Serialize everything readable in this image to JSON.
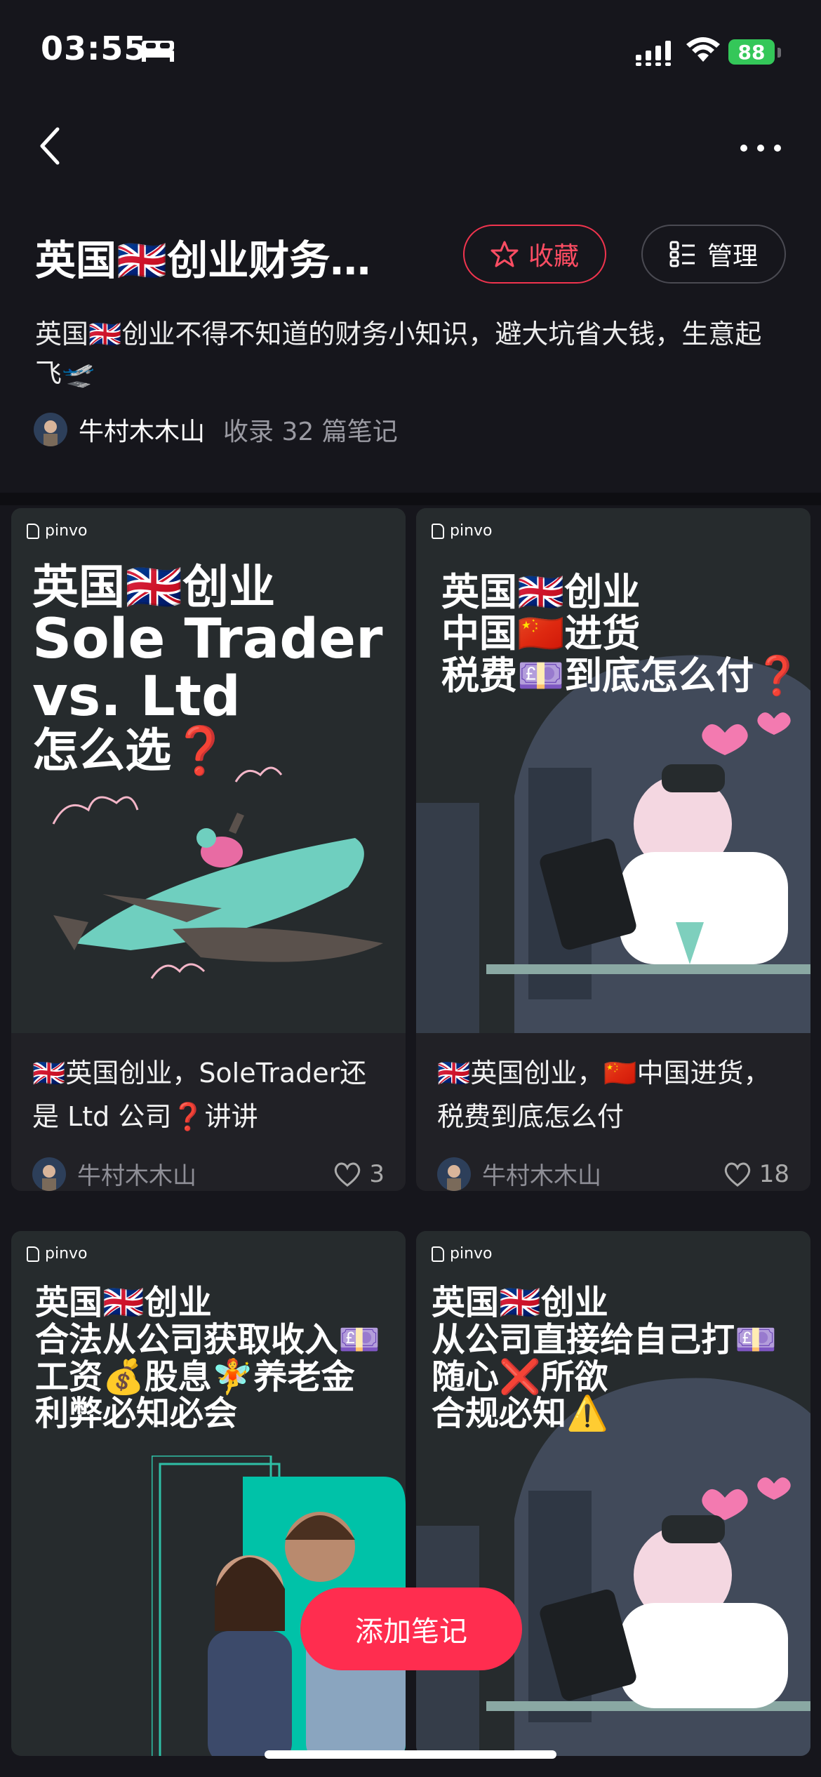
{
  "status_bar": {
    "time": "03:55",
    "battery": "88"
  },
  "header": {
    "title": "英国🇬🇧创业财务…",
    "favorite_label": "收藏",
    "manage_label": "管理"
  },
  "collection": {
    "description": " 英国🇬🇧创业不得不知道的财务小知识，避大坑省大钱，生意起飞🛫",
    "author": "牛村木木山",
    "count_text": "收录 32 篇笔记"
  },
  "cards": [
    {
      "brand": "pinvo",
      "headline": [
        "英国🇬🇧创业",
        "Sole Trader",
        "vs. Ltd",
        "怎么选❓"
      ],
      "caption": "🇬🇧英国创业，SoleTrader还是 Ltd 公司❓讲讲",
      "author": "牛村木木山",
      "likes": "3"
    },
    {
      "brand": "pinvo",
      "headline": [
        "英国🇬🇧创业",
        "中国🇨🇳进货",
        "税费💷到底怎么付❓"
      ],
      "caption": "🇬🇧英国创业，🇨🇳中国进货，税费到底怎么付",
      "author": "牛村木木山",
      "likes": "18"
    },
    {
      "brand": "pinvo",
      "headline": [
        "英国🇬🇧创业",
        "合法从公司获取收入💷",
        "工资💰股息🧚养老金",
        "利弊必知必会"
      ]
    },
    {
      "brand": "pinvo",
      "headline": [
        "英国🇬🇧创业",
        "从公司直接给自己打💷",
        "随心❌所欲",
        "合规必知⚠️"
      ]
    }
  ],
  "add_note_label": "添加笔记",
  "colors": {
    "accent": "#ff2d4f",
    "background": "#16161c",
    "card": "#212126"
  }
}
